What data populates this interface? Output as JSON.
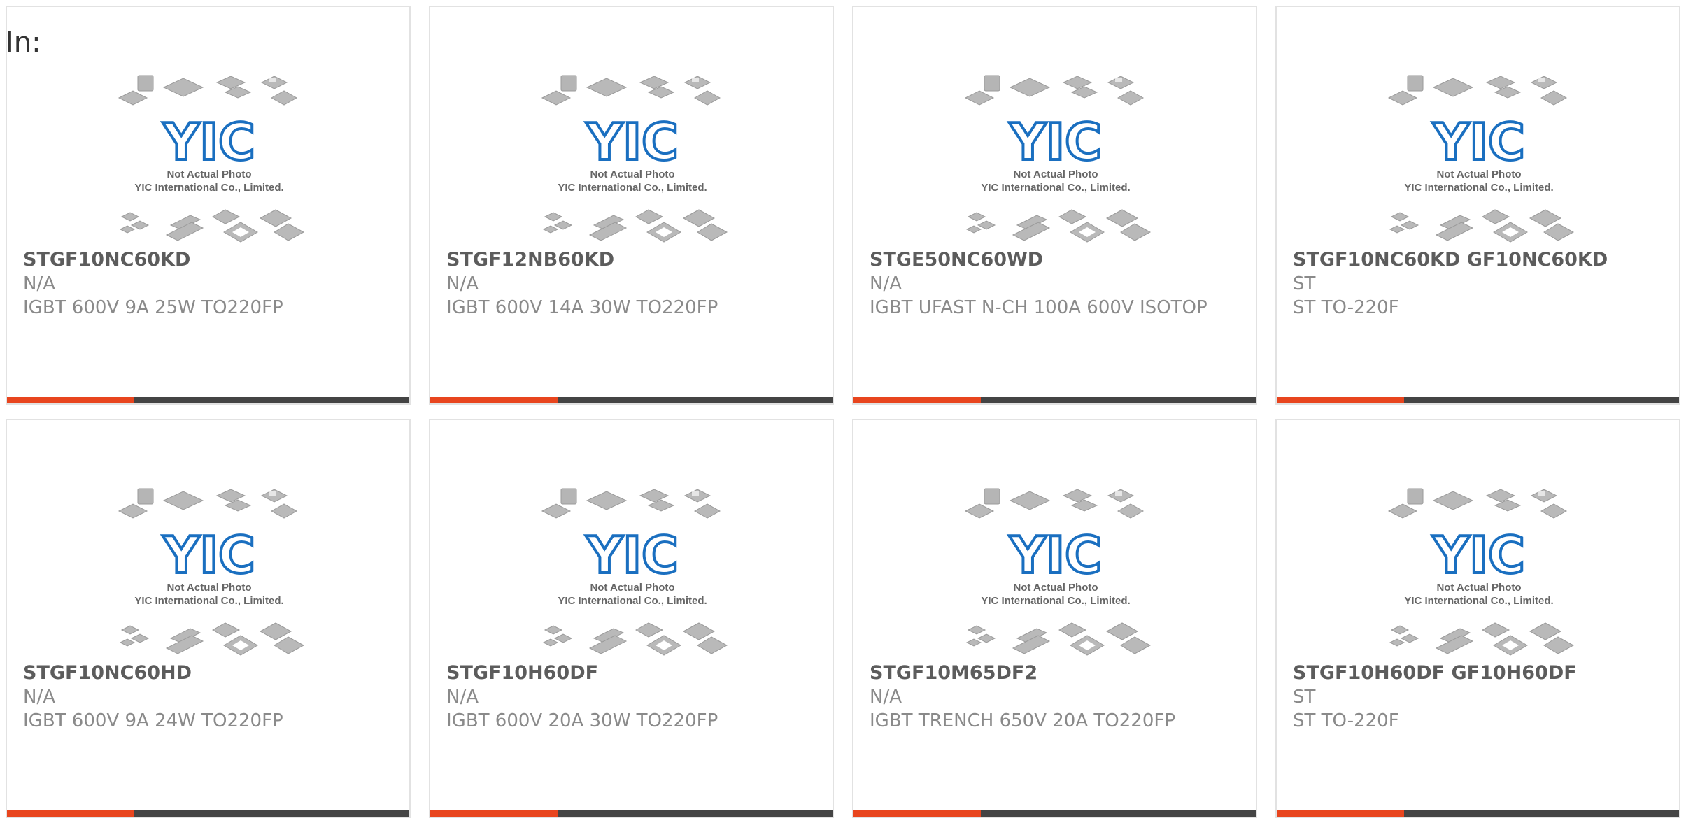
{
  "page": {
    "label": "In:"
  },
  "thumbnail": {
    "logo_text": "YIC",
    "caption_line1": "Not Actual Photo",
    "caption_line2": "YIC International Co., Limited."
  },
  "colors": {
    "accent": "#e8451e",
    "bar": "#444444",
    "border": "#e2e2e2",
    "logo": "#1a6fc0"
  },
  "products": [
    {
      "part": "STGF10NC60KD",
      "mfr": "N/A",
      "desc": "IGBT 600V 9A 25W TO220FP"
    },
    {
      "part": "STGF12NB60KD",
      "mfr": "N/A",
      "desc": "IGBT 600V 14A 30W TO220FP"
    },
    {
      "part": "STGE50NC60WD",
      "mfr": "N/A",
      "desc": "IGBT UFAST N-CH 100A 600V ISOTOP"
    },
    {
      "part": "STGF10NC60KD GF10NC60KD",
      "mfr": "ST",
      "desc": "ST TO-220F"
    },
    {
      "part": "STGF10NC60HD",
      "mfr": "N/A",
      "desc": "IGBT 600V 9A 24W TO220FP"
    },
    {
      "part": "STGF10H60DF",
      "mfr": "N/A",
      "desc": "IGBT 600V 20A 30W TO220FP"
    },
    {
      "part": "STGF10M65DF2",
      "mfr": "N/A",
      "desc": "IGBT TRENCH 650V 20A TO220FP"
    },
    {
      "part": "STGF10H60DF GF10H60DF",
      "mfr": "ST",
      "desc": "ST TO-220F"
    }
  ]
}
